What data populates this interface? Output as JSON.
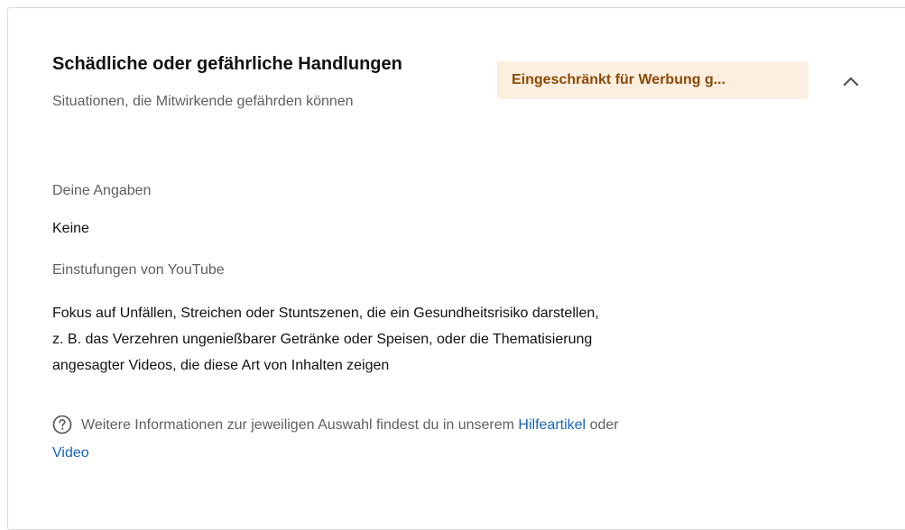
{
  "card": {
    "title": "Schädliche oder gefährliche Handlungen",
    "subtitle": "Situationen, die Mitwirkende gefährden können",
    "badge": "Eingeschränkt für Werbung g...",
    "chevron_icon": "chevron-up-icon"
  },
  "your_input": {
    "label": "Deine Angaben",
    "value": "Keine"
  },
  "youtube_rating": {
    "label": "Einstufungen von YouTube",
    "description_lines": [
      "Fokus auf Unfällen, Streichen oder Stuntszenen, die ein Gesundheitsrisiko darstellen,",
      "z. B. das Verzehren ungenießbarer Getränke oder Speisen, oder die Thematisierung",
      "angesagter Videos, die diese Art von Inhalten zeigen"
    ]
  },
  "info": {
    "icon": "help-circle-icon",
    "text": "Weitere Informationen zur jeweiligen Auswahl findest du in unserem",
    "link1": "Hilfeartikel",
    "connector": "oder",
    "link2": "Video"
  },
  "colors": {
    "badge_bg": "#fcefe0",
    "badge_text": "#8a4a06",
    "link": "#1565c0"
  }
}
